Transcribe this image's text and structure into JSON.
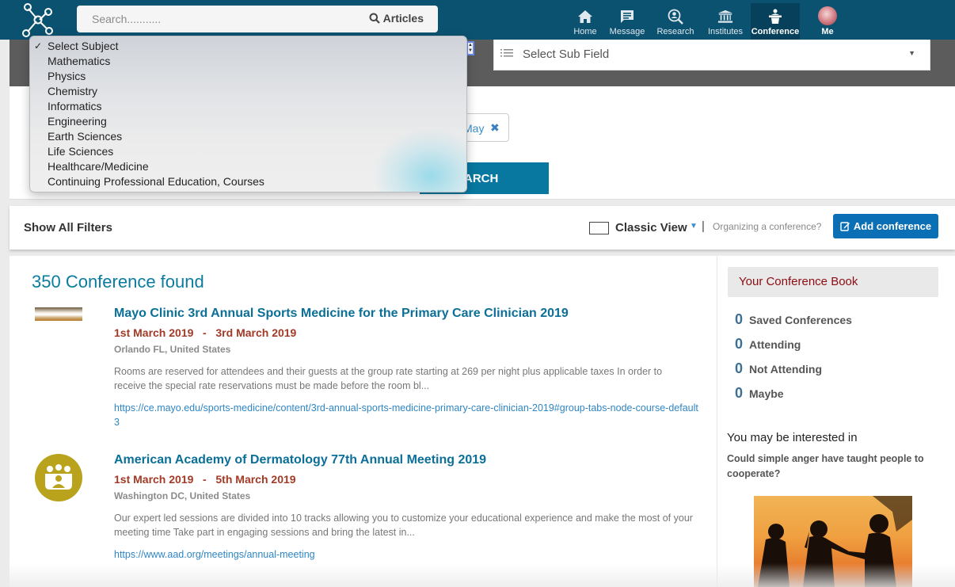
{
  "topbar": {
    "search_placeholder": "Search...........",
    "articles_label": "Articles",
    "nav": [
      {
        "label": "Home",
        "icon": "home-icon"
      },
      {
        "label": "Message",
        "icon": "message-icon"
      },
      {
        "label": "Research",
        "icon": "research-icon"
      },
      {
        "label": "Institutes",
        "icon": "institutes-icon"
      },
      {
        "label": "Conference",
        "icon": "conference-icon",
        "active": true
      },
      {
        "label": "Me",
        "icon": "avatar"
      }
    ]
  },
  "filters": {
    "subject_dropdown": {
      "selected": "Select Subject",
      "options": [
        "Select Subject",
        "Mathematics",
        "Physics",
        "Chemistry",
        "Informatics",
        "Engineering",
        "Earth Sciences",
        "Life Sciences",
        "Healthcare/Medicine",
        "Continuing Professional Education, Courses"
      ]
    },
    "subfield_placeholder": "Select Sub Field",
    "tag_label": "May",
    "search_button": "SEARCH"
  },
  "toolbar": {
    "show_all_filters": "Show All Filters",
    "view_label": "Classic View",
    "pipe": "|",
    "organizing_text": "Organizing a conference?",
    "add_conference": "Add conference"
  },
  "results": {
    "count_text": "350 Conference found",
    "items": [
      {
        "title": "Mayo Clinic 3rd Annual Sports Medicine for the Primary Care Clinician 2019",
        "date_range": "1st March 2019   -   3rd March 2019",
        "location": "Orlando FL, United States",
        "description": "Rooms are reserved for attendees and their guests at the group rate starting at 269 per night plus applicable taxes In order to receive the special rate reservations must be made before the room bl...",
        "link": "https://ce.mayo.edu/sports-medicine/content/3rd-annual-sports-medicine-primary-care-clinician-2019#group-tabs-node-course-default3"
      },
      {
        "title": "American Academy of Dermatology 77th Annual Meeting 2019",
        "date_range": "1st March 2019   -   5th March 2019",
        "location": "Washington DC, United States",
        "description": "Our expert led sessions are divided into 10 tracks allowing you to customize your educational experience and make the most of your meeting time Take part in engaging sessions and bring the latest in...",
        "link": "https://www.aad.org/meetings/annual-meeting"
      }
    ]
  },
  "sidebar": {
    "book_title": "Your Conference Book",
    "stats": [
      {
        "count": "0",
        "label": "Saved Conferences"
      },
      {
        "count": "0",
        "label": "Attending"
      },
      {
        "count": "0",
        "label": "Not Attending"
      },
      {
        "count": "0",
        "label": "Maybe"
      }
    ],
    "interest_heading": "You may be interested in",
    "interest_title": "Could simple anger have taught people to cooperate?"
  },
  "colors": {
    "topbar": "#0b5270",
    "accent": "#0b6f98",
    "date": "#a23a26",
    "add_button": "#0b6fb5",
    "book_title": "#8b0d12"
  }
}
